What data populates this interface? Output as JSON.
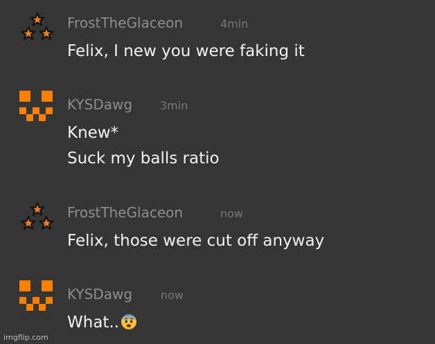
{
  "messages": [
    {
      "avatar_icon": "star-triangle-icon",
      "username": "FrostTheGlaceon",
      "time": "4min",
      "lines": [
        "Felix, I new you were faking it"
      ]
    },
    {
      "avatar_icon": "pixel-face-icon",
      "username": "KYSDawg",
      "time": "3min",
      "lines": [
        "Knew*",
        "Suck my balls ratio"
      ]
    },
    {
      "avatar_icon": "star-triangle-icon",
      "username": "FrostTheGlaceon",
      "time": "now",
      "lines": [
        "Felix, those were cut off anyway"
      ]
    },
    {
      "avatar_icon": "pixel-face-icon",
      "username": "KYSDawg",
      "time": "now",
      "lines": [
        "What.."
      ],
      "emoji_icon": "fearful-face-emoji-icon"
    }
  ],
  "watermark": "imgflip.com",
  "colors": {
    "background": "#353535",
    "username": "#8e8e8e",
    "timestamp": "#7a7a7a",
    "message_text": "#f2f2f2",
    "star_fill": "#f07f1e",
    "pixel_avatar": "#ff7f00"
  }
}
